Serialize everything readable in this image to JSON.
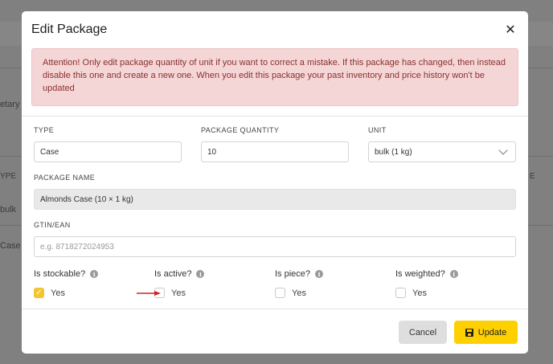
{
  "background": {
    "fragments": [
      "etary",
      "YPE",
      "bulk",
      "Case",
      "E"
    ]
  },
  "modal": {
    "title": "Edit Package",
    "close_icon": "close-icon",
    "alert_text": "Attention! Only edit package quantity of unit if you want to correct a mistake. If this package has changed, then instead disable this one and create a new one. When you edit this package your past inventory and price history won't be updated"
  },
  "form": {
    "type": {
      "label": "TYPE",
      "value": "Case"
    },
    "package_quantity": {
      "label": "PACKAGE QUANTITY",
      "value": "10"
    },
    "unit": {
      "label": "UNIT",
      "value": "bulk (1 kg)"
    },
    "package_name": {
      "label": "PACKAGE NAME",
      "value": "Almonds Case (10 × 1 kg)"
    },
    "gtin": {
      "label": "GTIN/EAN",
      "value": "",
      "placeholder": "e.g. 8718272024953"
    }
  },
  "checks": [
    {
      "title": "Is stockable?",
      "option": "Yes",
      "checked": true
    },
    {
      "title": "Is active?",
      "option": "Yes",
      "checked": false
    },
    {
      "title": "Is piece?",
      "option": "Yes",
      "checked": false
    },
    {
      "title": "Is weighted?",
      "option": "Yes",
      "checked": false
    }
  ],
  "footer": {
    "cancel_label": "Cancel",
    "update_label": "Update"
  },
  "colors": {
    "accent": "#ffd000",
    "checkbox_checked": "#f4c531",
    "alert_bg": "#f5d6d6",
    "alert_text": "#8a3030",
    "annotation_arrow": "#d62020"
  }
}
